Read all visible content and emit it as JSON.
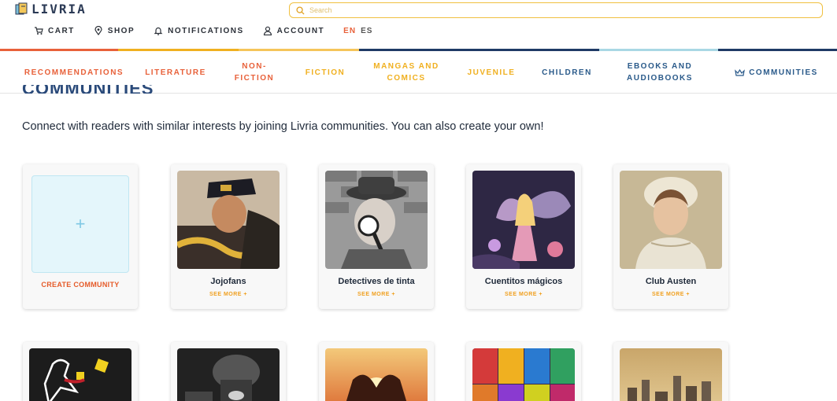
{
  "brand": {
    "name": "LIVRIA"
  },
  "search": {
    "placeholder": "Search"
  },
  "topnav": {
    "cart": "CART",
    "shop": "SHOP",
    "notifications": "NOTIFICATIONS",
    "account": "ACCOUNT",
    "lang_en": "EN",
    "lang_es": "ES"
  },
  "categories": [
    {
      "label_lines": [
        "RECOMMENDATIONS"
      ],
      "color": "#e8613a"
    },
    {
      "label_lines": [
        "LITERATURE"
      ],
      "color": "#e8613a"
    },
    {
      "label_lines": [
        "NON-",
        "FICTION"
      ],
      "color": "#e8613a"
    },
    {
      "label_lines": [
        "FICTION"
      ],
      "color": "#f0b020"
    },
    {
      "label_lines": [
        "MANGAS AND",
        "COMICS"
      ],
      "color": "#f0b020"
    },
    {
      "label_lines": [
        "JUVENILE"
      ],
      "color": "#f0b020"
    },
    {
      "label_lines": [
        "CHILDREN"
      ],
      "color": "#2a5a8a"
    },
    {
      "label_lines": [
        "EBOOKS AND",
        "AUDIOBOOKS"
      ],
      "color": "#2a5a8a"
    },
    {
      "label_lines": [
        "COMMUNITIES"
      ],
      "color": "#2a5a8a"
    }
  ],
  "page": {
    "heading": "COMMUNITIES",
    "intro": "Connect with readers with similar interests by joining Livria communities. You can also create your own!"
  },
  "create_card": {
    "plus": "+",
    "label": "CREATE COMMUNITY"
  },
  "communities": [
    {
      "name": "Jojofans",
      "more": "SEE MORE +"
    },
    {
      "name": "Detectives de tinta",
      "more": "SEE MORE +"
    },
    {
      "name": "Cuentitos mágicos",
      "more": "SEE MORE +"
    },
    {
      "name": "Club Austen",
      "more": "SEE MORE +"
    }
  ],
  "colors": {
    "orange": "#e8613a",
    "yellow": "#f0b020",
    "navy": "#1f3a66",
    "light_blue": "#a9d8e4"
  }
}
